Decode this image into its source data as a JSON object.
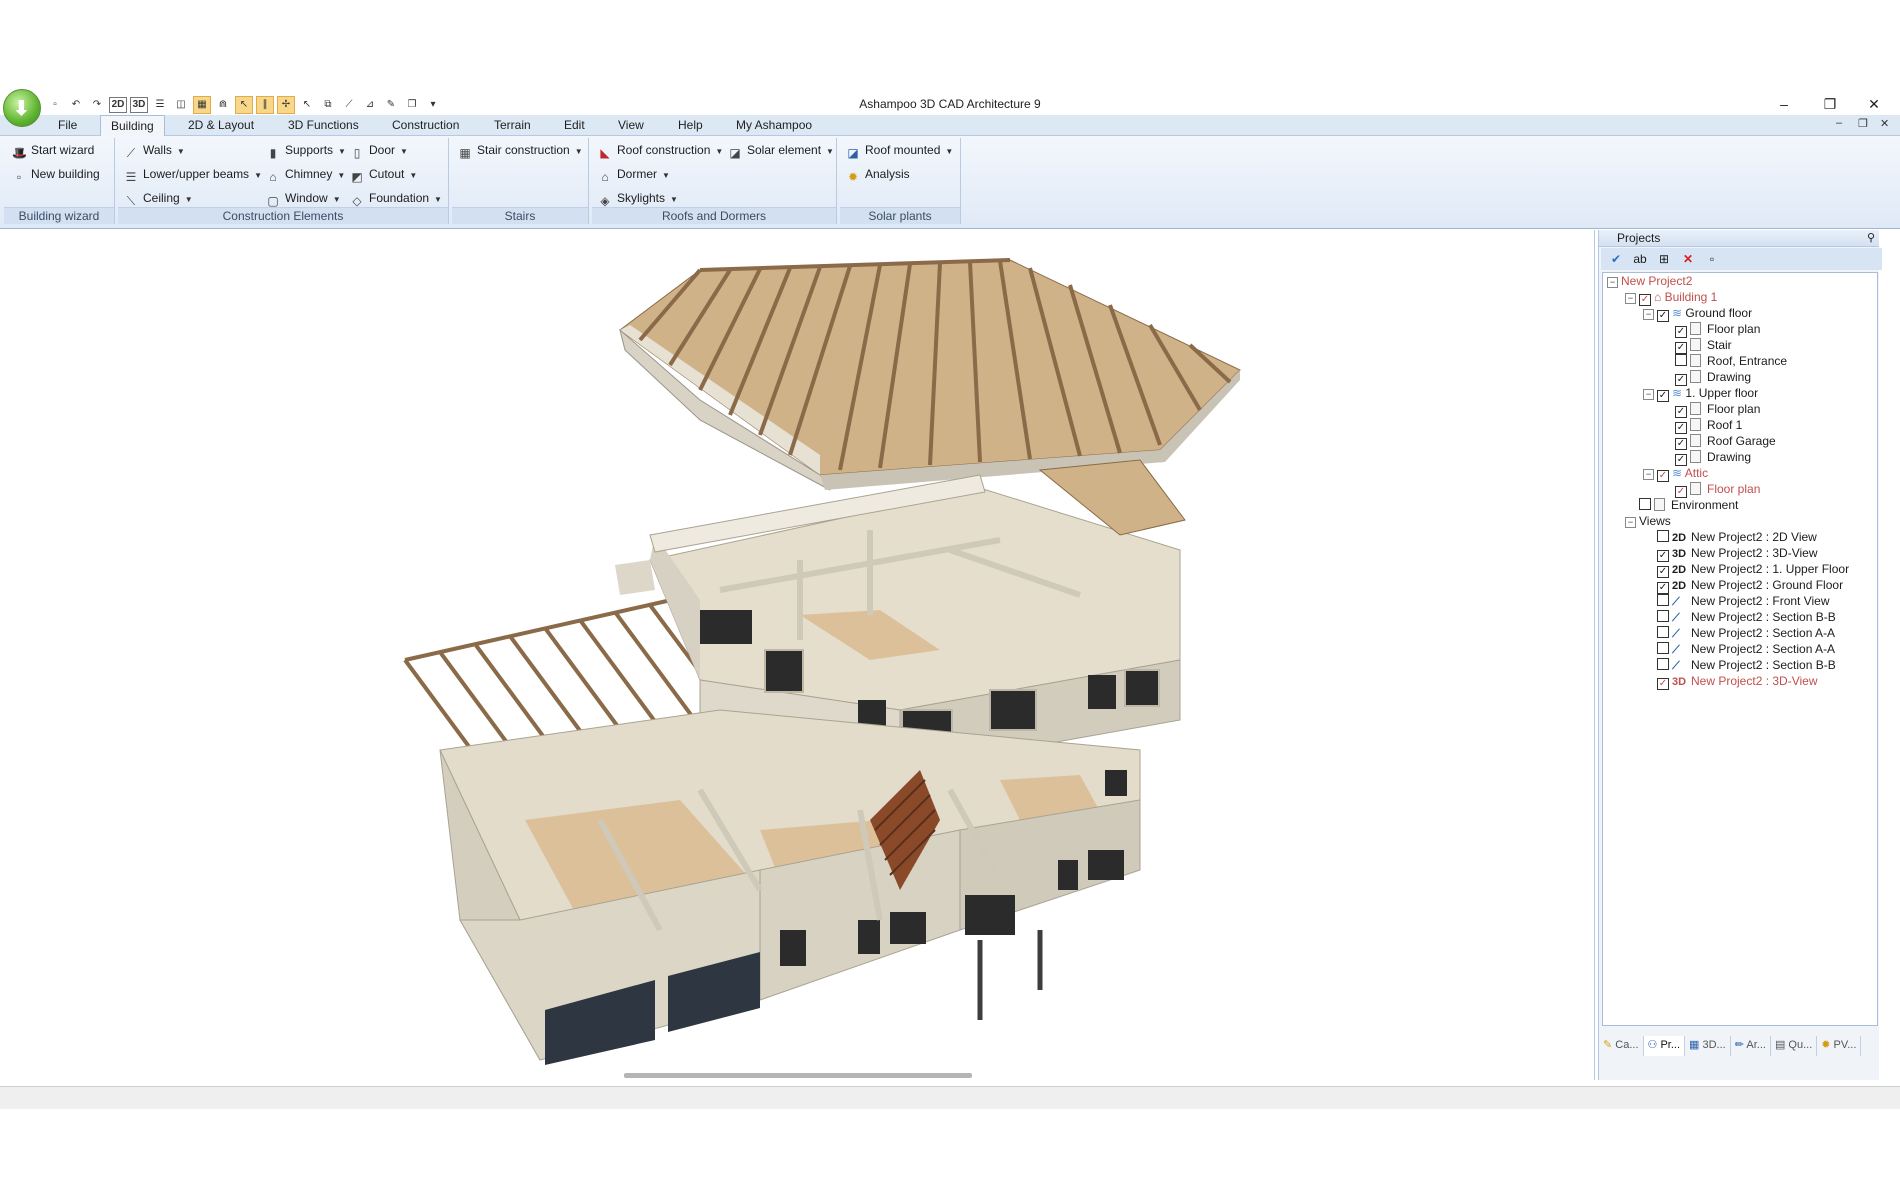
{
  "app": {
    "title": "Ashampoo 3D CAD Architecture 9"
  },
  "window": {
    "minimize": "–",
    "maximize": "❐",
    "close": "✕"
  },
  "qat": {
    "btn_2d": "2D",
    "btn_3d": "3D",
    "more": "▾"
  },
  "menu": {
    "tabs": [
      "File",
      "Building",
      "2D & Layout",
      "3D Functions",
      "Construction",
      "Terrain",
      "Edit",
      "View",
      "Help",
      "My Ashampoo"
    ],
    "active": "Building",
    "mdi": {
      "minimize": "–",
      "restore": "❐",
      "close": "✕"
    }
  },
  "ribbon": {
    "groups": {
      "building_wizard": {
        "label": "Building wizard",
        "start_wizard": "Start wizard",
        "new_building": "New building"
      },
      "construction_elements": {
        "label": "Construction Elements",
        "walls": "Walls",
        "lower_upper_beams": "Lower/upper beams",
        "ceiling": "Ceiling",
        "supports": "Supports",
        "chimney": "Chimney",
        "window": "Window",
        "door": "Door",
        "cutout": "Cutout",
        "foundation": "Foundation"
      },
      "stairs": {
        "label": "Stairs",
        "stair_construction": "Stair construction"
      },
      "roofs_dormers": {
        "label": "Roofs and Dormers",
        "roof_construction": "Roof construction",
        "dormer": "Dormer",
        "skylights": "Skylights",
        "solar_element": "Solar element"
      },
      "solar_plants": {
        "label": "Solar plants",
        "roof_mounted": "Roof mounted",
        "analysis": "Analysis"
      }
    }
  },
  "projects": {
    "title": "Projects",
    "tree": {
      "project": "New Project2",
      "building": "Building 1",
      "ground_floor": {
        "label": "Ground floor",
        "items": [
          "Floor plan",
          "Stair",
          "Roof, Entrance",
          "Drawing"
        ]
      },
      "upper_floor": {
        "label": "1. Upper floor",
        "items": [
          "Floor plan",
          "Roof 1",
          "Roof Garage",
          "Drawing"
        ]
      },
      "attic": {
        "label": "Attic",
        "items": [
          "Floor plan"
        ]
      },
      "environment": "Environment",
      "views_label": "Views",
      "views": [
        {
          "tag": "2D",
          "label": "New Project2 : 2D View",
          "checked": false
        },
        {
          "tag": "3D",
          "label": "New Project2 : 3D-View",
          "checked": true
        },
        {
          "tag": "2D",
          "label": "New Project2 : 1. Upper Floor",
          "checked": true
        },
        {
          "tag": "2D",
          "label": "New Project2 : Ground Floor",
          "checked": true
        },
        {
          "tag": "",
          "label": "New Project2 : Front View",
          "checked": false
        },
        {
          "tag": "",
          "label": "New Project2 : Section B-B",
          "checked": false
        },
        {
          "tag": "",
          "label": "New Project2 : Section A-A",
          "checked": false
        },
        {
          "tag": "",
          "label": "New Project2 : Section A-A",
          "checked": false
        },
        {
          "tag": "",
          "label": "New Project2 : Section B-B",
          "checked": false
        },
        {
          "tag": "3D",
          "label": "New Project2 : 3D-View",
          "checked": true
        }
      ]
    },
    "bottom_tabs": [
      "Ca...",
      "Pr...",
      "3D...",
      "Ar...",
      "Qu...",
      "PV..."
    ],
    "active_tab": "Pr..."
  },
  "colors": {
    "ribbon": "#dfe9f6",
    "accent_red": "#c0504d",
    "wall": "#dcd8cc",
    "floor": "#dcc09a",
    "timber": "#9c7650"
  }
}
